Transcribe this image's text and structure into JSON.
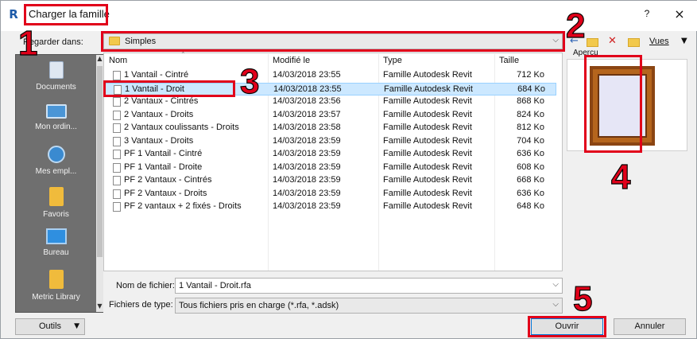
{
  "window": {
    "title": "Charger la famille",
    "help": "?",
    "close": "×"
  },
  "lookin": {
    "label": "Regarder dans:",
    "value": "Simples"
  },
  "toolbar": {
    "back_icon": "back-arrow-icon",
    "delete_icon": "delete-x-icon",
    "views_label": "Vues"
  },
  "places": [
    {
      "label": "Documents",
      "icon": "documents-icon"
    },
    {
      "label": "Mon ordin...",
      "icon": "computer-icon"
    },
    {
      "label": "Mes empl...",
      "icon": "network-icon"
    },
    {
      "label": "Favoris",
      "icon": "favorites-icon"
    },
    {
      "label": "Bureau",
      "icon": "desktop-icon"
    },
    {
      "label": "Metric Library",
      "icon": "library-icon"
    }
  ],
  "columns": {
    "name": "Nom",
    "date": "Modifié le",
    "type": "Type",
    "size": "Taille"
  },
  "files": [
    {
      "name": "1 Vantail - Cintré",
      "date": "14/03/2018 23:55",
      "type": "Famille Autodesk Revit",
      "size": "712 Ko",
      "selected": false
    },
    {
      "name": "1 Vantail - Droit",
      "date": "14/03/2018 23:55",
      "type": "Famille Autodesk Revit",
      "size": "684 Ko",
      "selected": true
    },
    {
      "name": "2 Vantaux - Cintrés",
      "date": "14/03/2018 23:56",
      "type": "Famille Autodesk Revit",
      "size": "868 Ko",
      "selected": false
    },
    {
      "name": "2 Vantaux - Droits",
      "date": "14/03/2018 23:57",
      "type": "Famille Autodesk Revit",
      "size": "824 Ko",
      "selected": false
    },
    {
      "name": "2 Vantaux coulissants - Droits",
      "date": "14/03/2018 23:58",
      "type": "Famille Autodesk Revit",
      "size": "812 Ko",
      "selected": false
    },
    {
      "name": "3 Vantaux - Droits",
      "date": "14/03/2018 23:59",
      "type": "Famille Autodesk Revit",
      "size": "704 Ko",
      "selected": false
    },
    {
      "name": "PF 1 Vantail - Cintré",
      "date": "14/03/2018 23:59",
      "type": "Famille Autodesk Revit",
      "size": "636 Ko",
      "selected": false
    },
    {
      "name": "PF 1 Vantail - Droite",
      "date": "14/03/2018 23:59",
      "type": "Famille Autodesk Revit",
      "size": "608 Ko",
      "selected": false
    },
    {
      "name": "PF 2 Vantaux - Cintrés",
      "date": "14/03/2018 23:59",
      "type": "Famille Autodesk Revit",
      "size": "668 Ko",
      "selected": false
    },
    {
      "name": "PF 2 Vantaux - Droits",
      "date": "14/03/2018 23:59",
      "type": "Famille Autodesk Revit",
      "size": "636 Ko",
      "selected": false
    },
    {
      "name": "PF 2 vantaux + 2 fixés - Droits",
      "date": "14/03/2018 23:59",
      "type": "Famille Autodesk Revit",
      "size": "648 Ko",
      "selected": false
    }
  ],
  "preview": {
    "label": "Aperçu"
  },
  "filename": {
    "label": "Nom de fichier:",
    "value": "1 Vantail - Droit.rfa"
  },
  "filetype": {
    "label": "Fichiers de type:",
    "value": "Tous fichiers pris en charge  (*.rfa, *.adsk)"
  },
  "buttons": {
    "tools": "Outils",
    "open": "Ouvrir",
    "cancel": "Annuler"
  },
  "annotations": [
    "1",
    "2",
    "3",
    "4",
    "5"
  ],
  "colors": {
    "annotation_red": "#e1001a",
    "selection": "#cce8ff",
    "places_bg": "#6f6f6f"
  }
}
